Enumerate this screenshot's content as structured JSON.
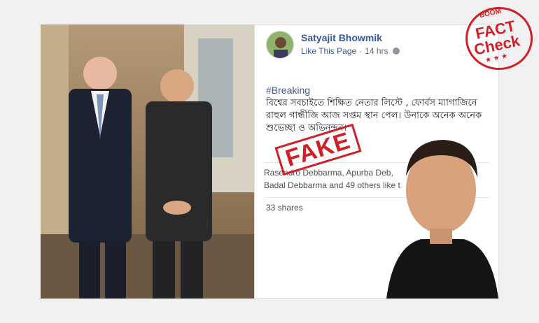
{
  "post": {
    "author": "Satyajit Bhowmik",
    "like_page": "Like This Page",
    "separator": "·",
    "time": "14 hrs",
    "privacy_icon": "globe-icon",
    "hashtag": "#Breaking",
    "text": "বিশ্বের সবচাইতে শিক্ষিত নেতার লিস্টে , ফোর্বস ম্যাগাজিনে রাহুল গান্ধীজি আজ সপ্তম স্থান পেল। উনাকে অনেক অনেক শুভেচ্ছা ও অভিনন্দন।",
    "likes_line1": "Rasendro Debbarma, Apurba Deb,",
    "likes_line2": "Badal Debbarma and 49 others like t",
    "shares": "33 shares"
  },
  "stamps": {
    "fake": "FAKE",
    "boom": "BOOM",
    "fact": "FACT",
    "check": "Check",
    "stars": "★ ★ ★",
    "color": "#d02027"
  },
  "colors": {
    "link": "#365899",
    "background": "#f1f1f1"
  }
}
